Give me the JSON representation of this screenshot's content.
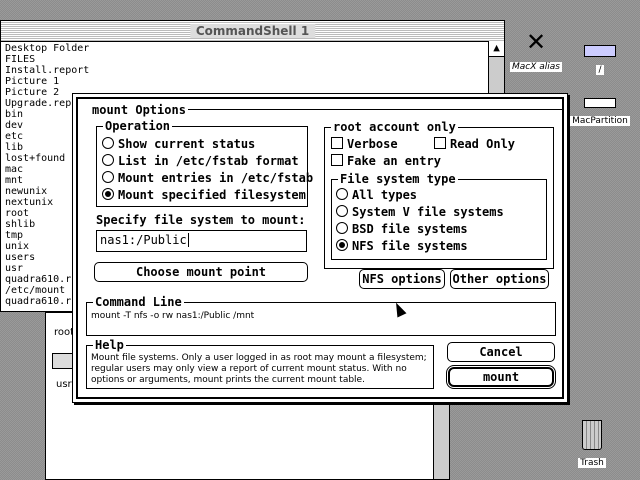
{
  "shell": {
    "title": "CommandShell 1",
    "lines": [
      "Desktop Folder",
      "FILES",
      "Install.report",
      "Picture 1",
      "Picture 2",
      "Upgrade.rep",
      "bin",
      "dev",
      "etc",
      "lib",
      "lost+found",
      "mac",
      "mnt",
      "newunix",
      "nextunix",
      "root",
      "shlib",
      "tmp",
      "unix",
      "users",
      "usr",
      "quadra610.r",
      "/etc/mount",
      "quadra610.r"
    ]
  },
  "finder": {
    "items": [
      "root",
      "usr"
    ]
  },
  "desktop": {
    "icons": [
      {
        "label": "MacX alias"
      },
      {
        "label": "/"
      },
      {
        "label": "MacPartition"
      },
      {
        "label": "Trash"
      }
    ]
  },
  "dialog": {
    "title": "mount Options",
    "operation": {
      "title": "Operation",
      "options": [
        "Show current status",
        "List in /etc/fstab format",
        "Mount entries in /etc/fstab",
        "Mount specified filesystem"
      ],
      "selected": 3
    },
    "specify_label": "Specify file system to mount:",
    "filesystem_value": "nas1:/Public",
    "choose_button": "Choose mount point",
    "root_account": {
      "title": "root account only",
      "verbose": "Verbose",
      "read_only": "Read Only",
      "fake_entry": "Fake an entry"
    },
    "fs_type": {
      "title": "File system type",
      "options": [
        "All types",
        "System V file systems",
        "BSD file systems",
        "NFS file systems"
      ],
      "selected": 3
    },
    "nfs_options_button": "NFS options",
    "other_options_button": "Other options",
    "command_line": {
      "title": "Command Line",
      "value": "mount -T nfs -o rw nas1:/Public /mnt"
    },
    "help": {
      "title": "Help",
      "text": "Mount file systems.  Only a user logged in as root may mount a filesystem; regular users may only view a report of current mount status.  With no options or arguments, mount prints the current mount table."
    },
    "cancel_button": "Cancel",
    "mount_button": "mount"
  }
}
